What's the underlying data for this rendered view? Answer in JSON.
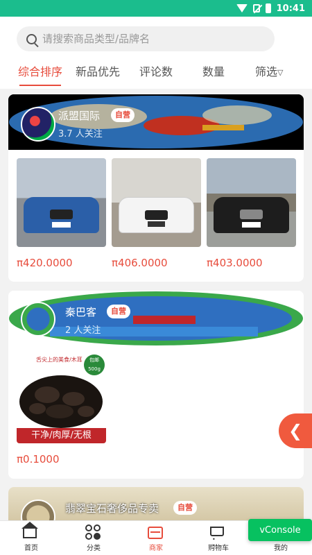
{
  "status": {
    "time": "10:41"
  },
  "search": {
    "placeholder": "请搜索商品类型/品牌名"
  },
  "sort_tabs": [
    {
      "label": "综合排序",
      "active": true
    },
    {
      "label": "新品优先"
    },
    {
      "label": "评论数"
    },
    {
      "label": "数量"
    },
    {
      "label": "筛选"
    }
  ],
  "shops": [
    {
      "name": "派盟国际",
      "tag": "自营",
      "followers": "3.7 人关注",
      "products": [
        {
          "price": "π420.0000",
          "image": "blue-mercedes-car",
          "color": "#2b5fa8"
        },
        {
          "price": "π406.0000",
          "image": "white-bmw-car",
          "color": "#f2f2f2"
        },
        {
          "price": "π403.0000",
          "image": "black-hongqi-car",
          "color": "#1d1d1d"
        }
      ]
    },
    {
      "name": "秦巴客",
      "tag": "自营",
      "followers": "2 人关注",
      "products": [
        {
          "price": "π0.1000",
          "image": "black-fungus-product",
          "promo": "干净/肉厚/无根",
          "top_caption": "舌尖上的美食/木耳",
          "badge": "包邮 500g"
        }
      ]
    },
    {
      "name": "翡翠宝石奢侈品专卖",
      "tag": "自营"
    }
  ],
  "float_button": {
    "icon": "chevron-left-icon",
    "glyph": "❮"
  },
  "bottom_nav": [
    {
      "label": "首页",
      "icon": "home-icon"
    },
    {
      "label": "分类",
      "icon": "category-icon"
    },
    {
      "label": "商家",
      "icon": "shop-icon",
      "active": true
    },
    {
      "label": "购物车",
      "icon": "cart-icon"
    },
    {
      "label": "我的",
      "icon": "user-icon"
    }
  ],
  "vconsole": {
    "label": "vConsole"
  },
  "colors": {
    "status_bar": "#1bbd8d",
    "accent": "#e74c3c",
    "vconsole": "#07c160"
  }
}
